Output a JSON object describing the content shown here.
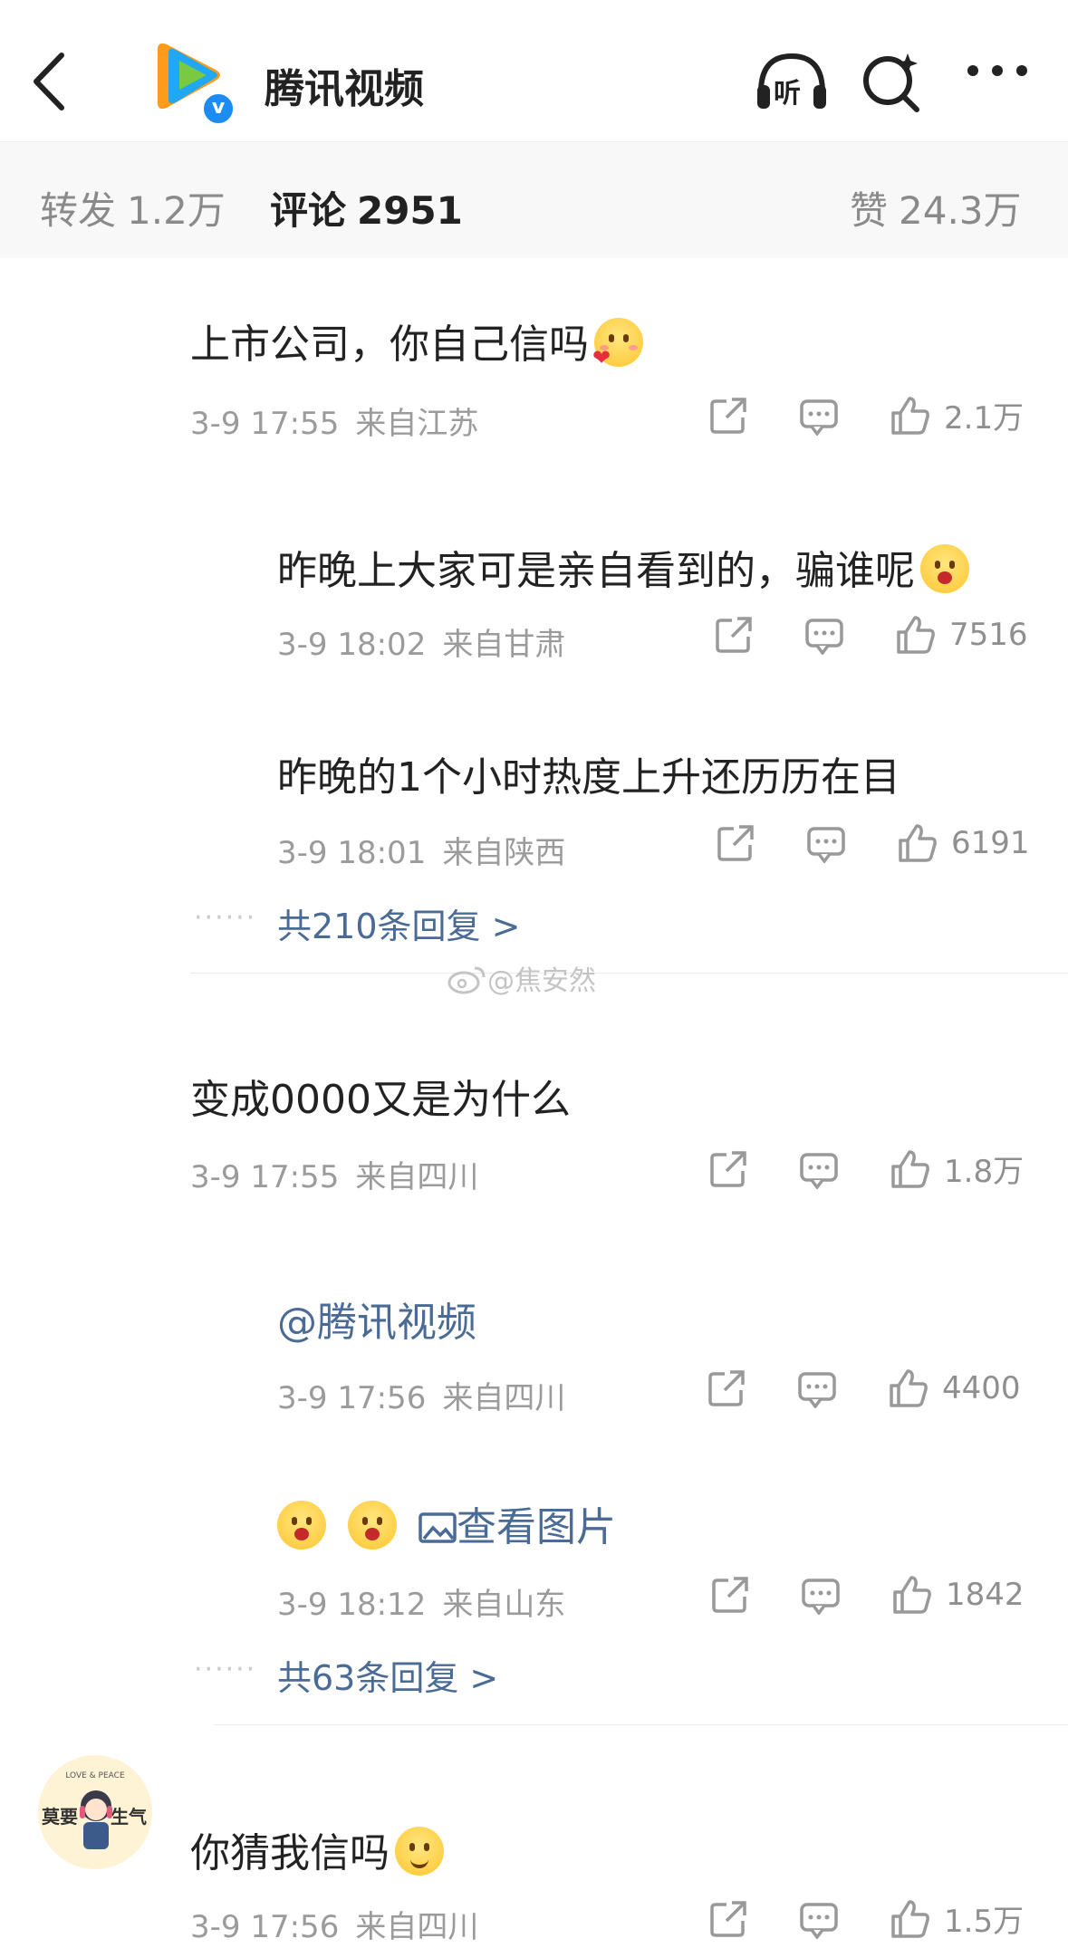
{
  "header": {
    "account_name": "腾讯视频",
    "listen_label": "听"
  },
  "tabs": {
    "repost_label": "转发",
    "repost_count": "1.2万",
    "comment_label": "评论",
    "comment_count": "2951",
    "like_label": "赞",
    "like_count": "24.3万"
  },
  "comments": [
    {
      "text": "上市公司，你自己信吗",
      "time": "3-9 17:55",
      "location": "来自江苏",
      "likes": "2.1万"
    },
    {
      "text": "昨晚上大家可是亲自看到的，骗谁呢",
      "time": "3-9 18:02",
      "location": "来自甘肃",
      "likes": "7516"
    },
    {
      "text": "昨晚的1个小时热度上升还历历在目",
      "time": "3-9 18:01",
      "location": "来自陕西",
      "likes": "6191"
    },
    {
      "text": "共210条回复 >"
    },
    {
      "text": "变成0000又是为什么",
      "time": "3-9 17:55",
      "location": "来自四川",
      "likes": "1.8万"
    },
    {
      "text": "@腾讯视频",
      "time": "3-9 17:56",
      "location": "来自四川",
      "likes": "4400"
    },
    {
      "text": "查看图片",
      "time": "3-9 18:12",
      "location": "来自山东",
      "likes": "1842"
    },
    {
      "text": "共63条回复 >"
    },
    {
      "text": "你猜我信吗",
      "time": "3-9 17:56",
      "location": "来自四川",
      "likes": "1.5万"
    }
  ],
  "watermark": "@焦安然",
  "avatar_text": {
    "top": "LOVE & PEACE",
    "left": "莫要",
    "right": "生气"
  },
  "colors": {
    "link": "#4a6b96",
    "meta": "#9b9b9b",
    "tab_bg": "#f8f8f8"
  }
}
